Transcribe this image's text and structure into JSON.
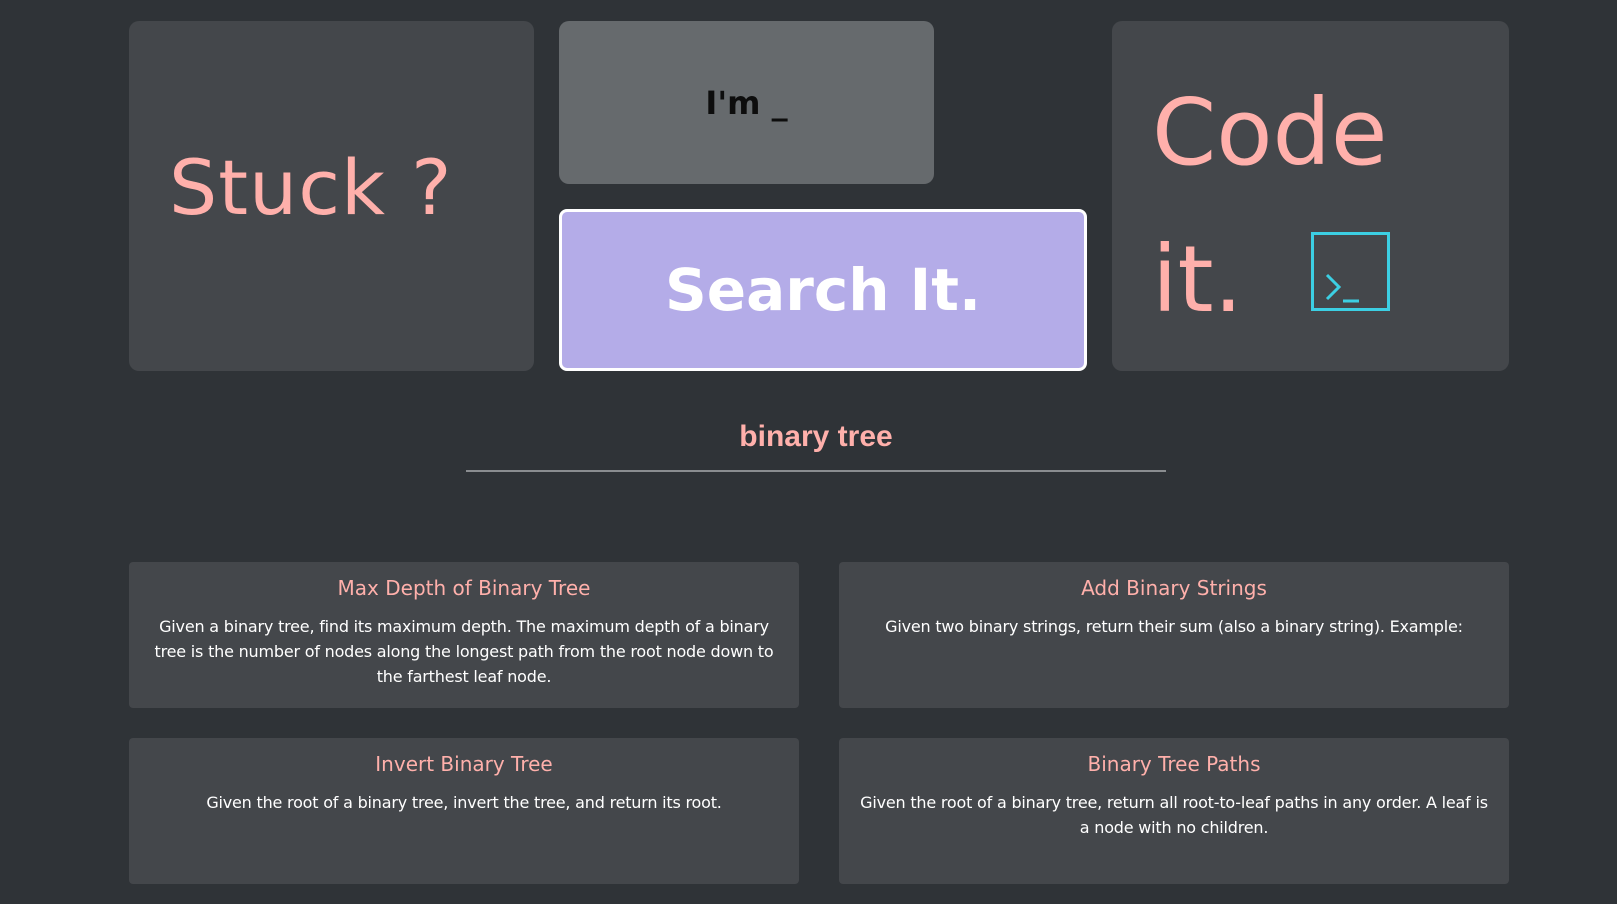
{
  "hero": {
    "stuck": "Stuck ?",
    "im_text": "I'm _",
    "search_button": "Search It.",
    "code_line1": "Code",
    "code_line2": "it."
  },
  "search": {
    "query": "binary tree"
  },
  "results": [
    {
      "title": "Max Depth of Binary Tree",
      "description": "Given a binary tree, find its maximum depth. The maximum depth of a binary tree is the number of nodes along the longest path from the root node down to the farthest leaf node."
    },
    {
      "title": "Add Binary Strings",
      "description": "Given two binary strings, return their sum (also a binary string). Example:"
    },
    {
      "title": "Invert Binary Tree",
      "description": "Given the root of a binary tree, invert the tree, and return its root."
    },
    {
      "title": "Binary Tree Paths",
      "description": "Given the root of a binary tree, return all root-to-leaf paths in any order. A leaf is a node with no children."
    }
  ],
  "icons": {
    "terminal": "terminal-icon"
  },
  "colors": {
    "background": "#2f3337",
    "tile": "#44474b",
    "accent_pink": "#ffb0ab",
    "search_purple": "#b4ace8",
    "terminal_cyan": "#3ccfe3"
  }
}
